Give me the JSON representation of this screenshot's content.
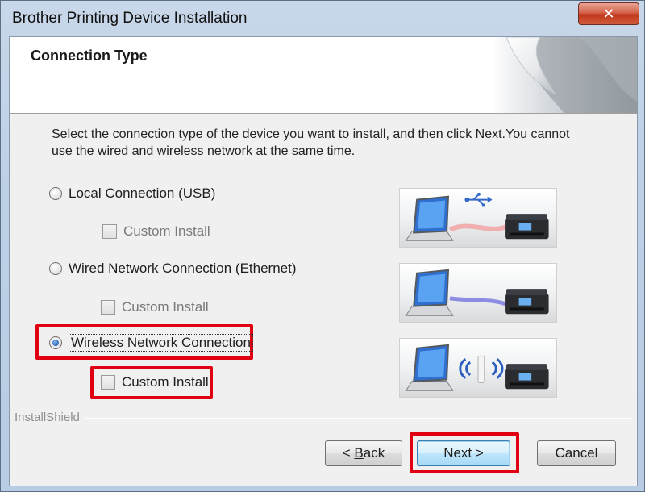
{
  "window": {
    "title": "Brother Printing Device Installation",
    "close_glyph": "✕"
  },
  "header": {
    "title": "Connection Type"
  },
  "instructions": "Select the connection type of the device you want to install, and then click Next.You cannot use the wired and wireless network at the same time.",
  "options": [
    {
      "label": "Local Connection (USB)",
      "selected": false,
      "custom_install_label": "Custom Install",
      "custom_install_enabled": false,
      "illustration": "usb-icon"
    },
    {
      "label": "Wired Network Connection (Ethernet)",
      "selected": false,
      "custom_install_label": "Custom Install",
      "custom_install_enabled": false,
      "illustration": "ethernet-cable"
    },
    {
      "label": "Wireless Network Connection",
      "selected": true,
      "custom_install_label": "Custom Install",
      "custom_install_enabled": true,
      "illustration": "wifi-access-point"
    }
  ],
  "branding": "InstallShield",
  "buttons": {
    "back_prefix": "< ",
    "back_accel": "B",
    "back_rest": "ack",
    "next": "Next >",
    "cancel": "Cancel"
  },
  "colors": {
    "highlight": "#e00012",
    "usb_line": "#f08080",
    "ethernet_line": "#6a6ad8",
    "wifi": "#2a5fc0"
  }
}
